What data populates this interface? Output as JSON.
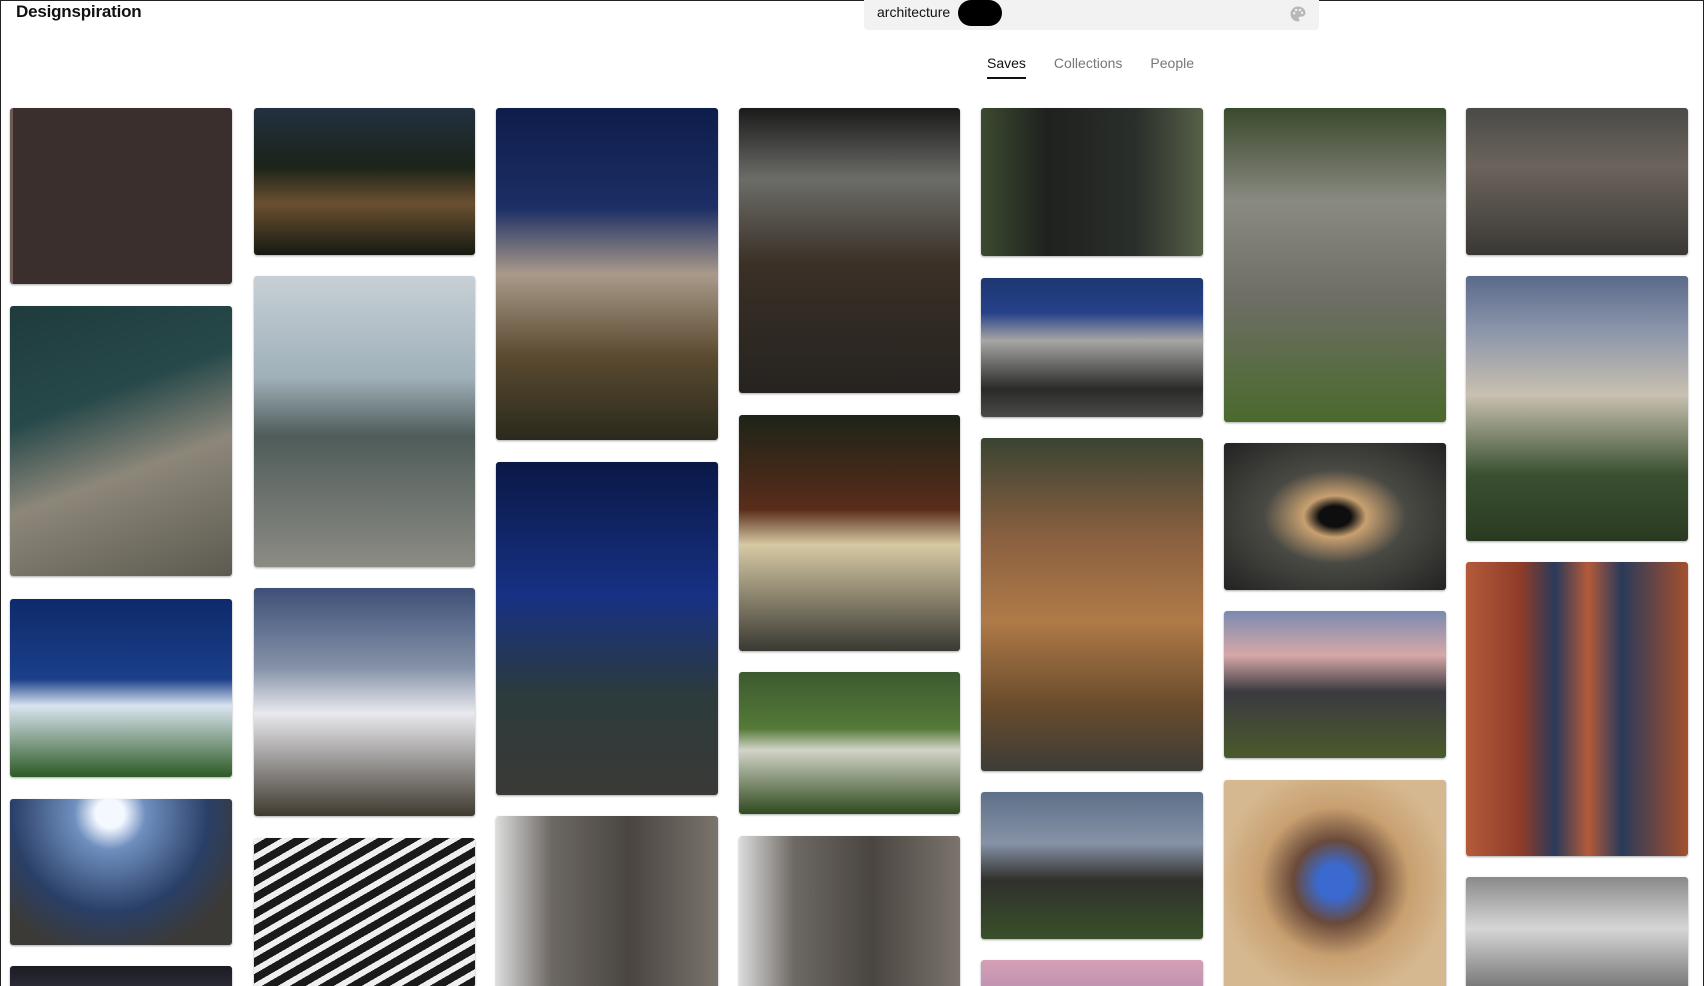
{
  "header": {
    "logo": "Designspiration",
    "search": {
      "query": "architecture",
      "palette_icon": "palette-icon"
    }
  },
  "tabs": [
    {
      "label": "Saves",
      "active": true
    },
    {
      "label": "Collections",
      "active": false
    },
    {
      "label": "People",
      "active": false
    }
  ],
  "columns": [
    {
      "tiles": [
        {
          "name": "highrise-facade-photo",
          "bg": "linear-gradient(90deg,#6e5a52 0 3px,#3a2f2c 3px 6px)"
        },
        {
          "name": "brutalist-tower-photo",
          "bg": "linear-gradient(160deg,#1f3b3c 0%,#27494a 35%,#8d877a 60%,#5c5a50 100%)"
        },
        {
          "name": "white-modern-villa-night-photo",
          "bg": "linear-gradient(180deg,#0e2a6b 0%,#1b3f8a 45%,#d9e4f0 60%,#2c5a24 100%)"
        },
        {
          "name": "cliff-black-house-photo",
          "bg": "radial-gradient(circle at 45% 10%,#f4f8ff 0 8%,#6f8fbf 20%,#2a3f66 55%,#3c3a36 80%)"
        },
        {
          "name": "partial-bottom-photo",
          "bg": "linear-gradient(180deg,#1b1b24,#3a3a44)"
        }
      ]
    },
    {
      "tiles": [
        {
          "name": "forest-cabin-night-photo",
          "bg": "linear-gradient(180deg,#223040 0%,#1b2418 40%,#6b5030 65%,#151a12 100%)"
        },
        {
          "name": "misty-mountain-cottages-photo",
          "bg": "linear-gradient(180deg,#c7d0d6 0%,#9fb0b9 35%,#4f5c5a 55%,#8c8c84 100%)"
        },
        {
          "name": "white-cube-house-dusk-photo",
          "bg": "linear-gradient(180deg,#3e5078 0%,#8592a8 35%,#e9e9ee 55%,#3f3a30 100%)"
        },
        {
          "name": "louvered-facade-bw-photo",
          "bg": "repeating-linear-gradient(150deg,#efefef 0 6px,#1a1a1a 6px 14px)"
        }
      ]
    },
    {
      "tiles": [
        {
          "name": "gable-barn-house-night-photo",
          "bg": "linear-gradient(180deg,#0e1d4a 0%,#1c2e66 30%,#a99a8a 50%,#5a4a30 75%,#2a2a1c 100%)"
        },
        {
          "name": "elevated-glass-box-night-photo",
          "bg": "linear-gradient(180deg,#0a1846 0%,#173184 40%,#2c3b3c 70%,#3a3a36 100%)"
        },
        {
          "name": "brick-house-photo",
          "bg": "linear-gradient(90deg,#dcdcdc 0%,#6d6863 25%,#4a4541 60%,#7a746d 100%)"
        }
      ]
    },
    {
      "tiles": [
        {
          "name": "concrete-stair-interior-photo",
          "bg": "linear-gradient(180deg,#1a1a1a 0%,#6c6c68 25%,#3a3026 55%,#262320 100%)"
        },
        {
          "name": "wood-cabin-fire-photo",
          "bg": "linear-gradient(180deg,#1c2418 0%,#5a2c1a 40%,#d7c9a4 55%,#3a3a33 100%)"
        },
        {
          "name": "hillside-glass-cube-photo",
          "bg": "linear-gradient(180deg,#3c5a30 0%,#557a38 40%,#d2d4c8 55%,#2f4a1e 100%)"
        },
        {
          "name": "brick-house-duplicate-photo",
          "bg": "linear-gradient(90deg,#dcdcdc 0%,#6d6863 25%,#4a4541 60%,#7a746d 100%)"
        }
      ]
    },
    {
      "tiles": [
        {
          "name": "black-brick-tower-forest-photo",
          "bg": "linear-gradient(90deg,#3c4a30 0%,#1e211e 30%,#2b2f2b 70%,#566048 100%)"
        },
        {
          "name": "concrete-facade-garage-photo",
          "bg": "linear-gradient(180deg,#1c3770 0%,#26418a 25%,#a6a6a4 45%,#2a2a28 80%,#4a4a48 100%)"
        },
        {
          "name": "wooden-terraced-house-photo",
          "bg": "linear-gradient(180deg,#3a4432 0%,#8a6040 30%,#b07a48 55%,#6a4c2c 80%,#3c3c36 100%)"
        },
        {
          "name": "farmhouse-dusk-photo",
          "bg": "linear-gradient(180deg,#5e7088 0%,#8692a6 35%,#30302c 60%,#39502a 100%)"
        },
        {
          "name": "sunset-sky-photo",
          "bg": "linear-gradient(180deg,#d6a0b4,#b08ab0)"
        }
      ]
    },
    {
      "tiles": [
        {
          "name": "overgrown-concrete-house-photo",
          "bg": "linear-gradient(180deg,#3a4a2c 0%,#8a8a82 30%,#6e6e66 60%,#4a6a2c 100%)"
        },
        {
          "name": "tunnel-symmetry-photo",
          "bg": "radial-gradient(ellipse at center,#0e0e0e 0 10%,#c8a070 20%,#4a4a44 45%,#222 100%)"
        },
        {
          "name": "modern-house-sunset-photo",
          "bg": "linear-gradient(180deg,#7a8ab0 0%,#d6a8a8 30%,#3a3a40 55%,#4a5a2c 100%)"
        },
        {
          "name": "fisheye-interior-photo",
          "bg": "radial-gradient(circle at 50% 45%,#3a6ad0 0 10%,#6a4a3a 25%,#c8a070 45%,#d6b890 70%)"
        }
      ]
    },
    {
      "tiles": [
        {
          "name": "industrial-interior-photo",
          "bg": "linear-gradient(180deg,#4a4a46 0%,#6c645c 40%,#3a3834 100%)"
        },
        {
          "name": "townhouse-dusk-photo",
          "bg": "linear-gradient(180deg,#5a6a8a 0%,#8a94aa 20%,#c8c0b0 45%,#3a5030 75%,#2a3a22 100%)"
        },
        {
          "name": "brick-spiral-stair-photo",
          "bg": "linear-gradient(90deg,#b45a3a 0%,#8e3c28 25%,#2a3a5a 40%,#b45a3a 55%,#2a3a5a 70%,#a4502e 100%)"
        },
        {
          "name": "modernist-terminal-bw-photo",
          "bg": "linear-gradient(180deg,#8a8a8a 0%,#d6d6d6 40%,#5a5a5a 100%)"
        }
      ]
    }
  ]
}
